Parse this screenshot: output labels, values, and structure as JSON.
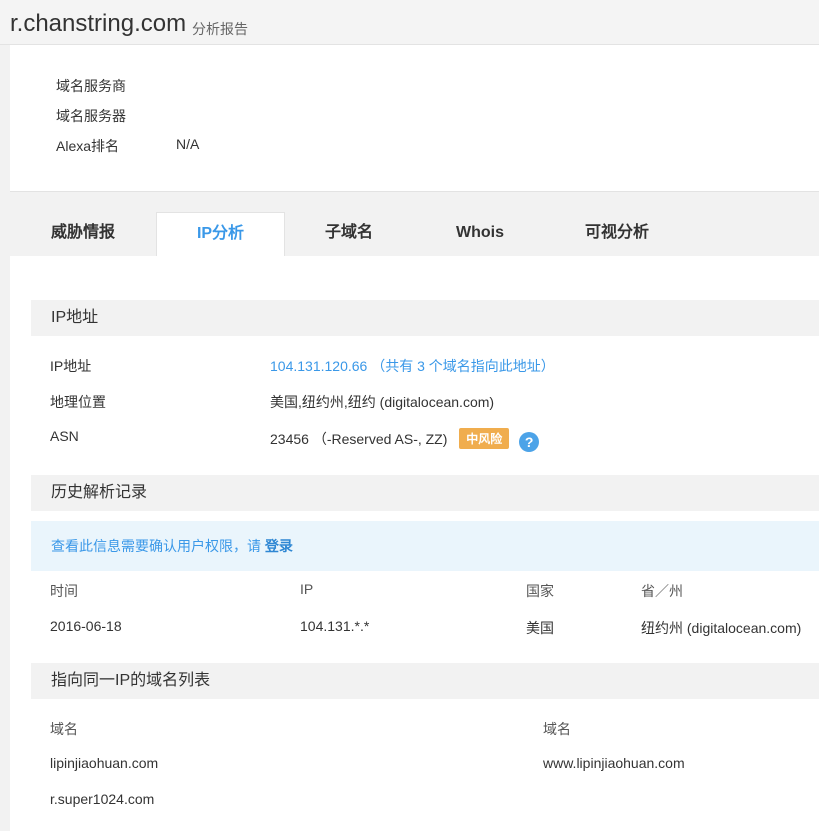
{
  "header": {
    "domain": "r.chanstring.com",
    "suffix": "分析报告"
  },
  "info": {
    "registrar_label": "域名服务商",
    "nameserver_label": "域名服务器",
    "alexa_label": "Alexa排名",
    "alexa_value": "N/A"
  },
  "tabs": [
    {
      "label": "威胁情报",
      "active": false
    },
    {
      "label": "IP分析",
      "active": true
    },
    {
      "label": "子域名",
      "active": false
    },
    {
      "label": "Whois",
      "active": false
    },
    {
      "label": "可视分析",
      "active": false
    }
  ],
  "ip_section": {
    "title": "IP地址",
    "ip_label": "IP地址",
    "ip_value": "104.131.120.66",
    "ip_note": "（共有 3 个域名指向此地址）",
    "geo_label": "地理位置",
    "geo_value": "美国,纽约州,纽约 (digitalocean.com)",
    "asn_label": "ASN",
    "asn_value": "23456 （-Reserved AS-, ZZ)",
    "risk_badge": "中风险",
    "help_icon": "question-icon",
    "risk_color": "#f0ad4e"
  },
  "history": {
    "title": "历史解析记录",
    "notice_text": "查看此信息需要确认用户权限，请",
    "notice_login": "登录",
    "columns": [
      "时间",
      "IP",
      "国家",
      "省／州"
    ],
    "rows": [
      [
        "2016-06-18",
        "104.131.*.*",
        "美国",
        "纽约州 (digitalocean.com)"
      ]
    ]
  },
  "same_ip": {
    "title": "指向同一IP的域名列表",
    "col_left": "域名",
    "col_right": "域名",
    "domains": [
      "lipinjiaohuan.com",
      "www.lipinjiaohuan.com",
      "r.super1024.com"
    ]
  },
  "colors": {
    "accent": "#3a98e8",
    "section_bg": "#f2f2f2",
    "notice_bg": "#eaf5fc"
  }
}
